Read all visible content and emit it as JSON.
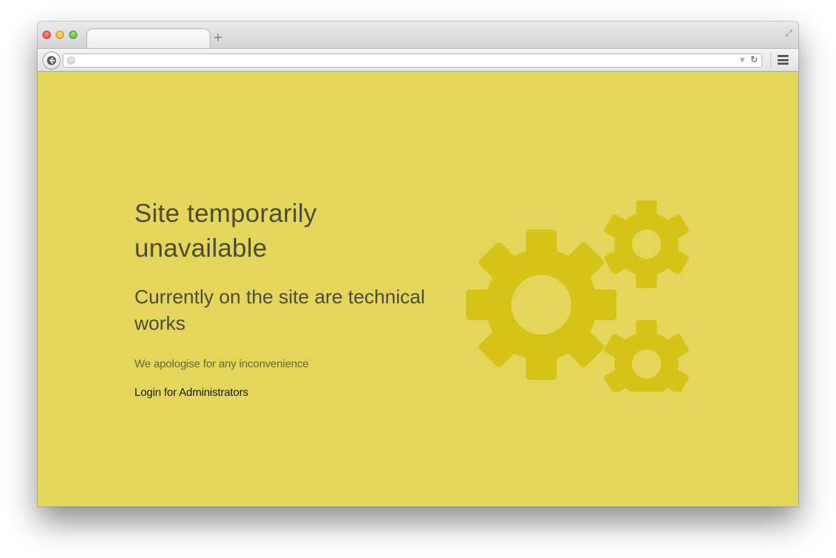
{
  "browser": {
    "tab_title": "",
    "new_tab_symbol": "+",
    "fullscreen_symbol": "⤢",
    "url": "",
    "dropdown_symbol": "▼",
    "reload_symbol": "↻"
  },
  "page": {
    "heading": "Site temporarily unavailable",
    "subheading": "Currently on the site are technical works",
    "apology": "We apologise for any inconvenience",
    "login_link": "Login for Administrators"
  },
  "colors": {
    "background": "#e4d65a",
    "gear": "#d6c318",
    "heading_text": "#4e4b3a"
  },
  "icons": {
    "illustration": "gears-icon",
    "back": "back-arrow-icon",
    "menu": "hamburger-menu-icon"
  }
}
